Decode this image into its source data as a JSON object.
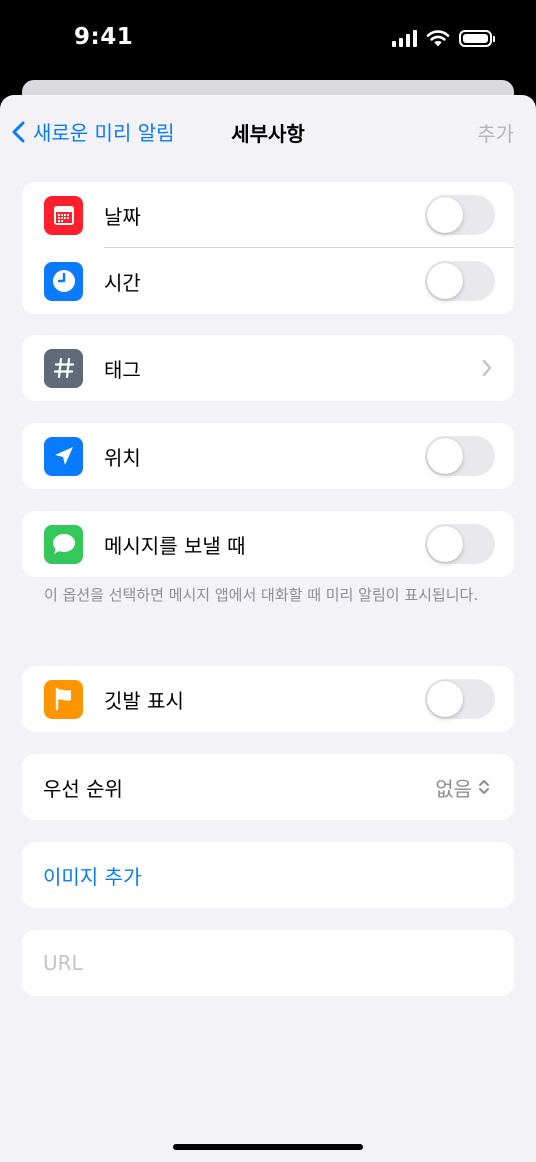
{
  "status_bar": {
    "time": "9:41"
  },
  "nav": {
    "back_label": "새로운 미리 알림",
    "title": "세부사항",
    "add_label": "추가"
  },
  "rows": {
    "date": {
      "label": "날짜",
      "icon": "calendar-icon",
      "color": "#ff1f2d",
      "on": false
    },
    "time": {
      "label": "시간",
      "icon": "clock-icon",
      "color": "#0a7aff",
      "on": false
    },
    "tag": {
      "label": "태그",
      "icon": "hashtag-icon",
      "color": "#5e6a77"
    },
    "location": {
      "label": "위치",
      "icon": "location-arrow-icon",
      "color": "#0a7aff",
      "on": false
    },
    "messaging": {
      "label": "메시지를 보낼 때",
      "icon": "message-bubble-icon",
      "color": "#34c759",
      "on": false
    },
    "flag": {
      "label": "깃발 표시",
      "icon": "flag-icon",
      "color": "#ff9500",
      "on": false
    },
    "priority": {
      "label": "우선 순위",
      "value": "없음"
    },
    "add_image": {
      "label": "이미지 추가"
    },
    "url": {
      "placeholder": "URL"
    }
  },
  "footnote": "이 옵션을 선택하면 메시지 앱에서 대화할 때 미리 알림이 표시됩니다."
}
